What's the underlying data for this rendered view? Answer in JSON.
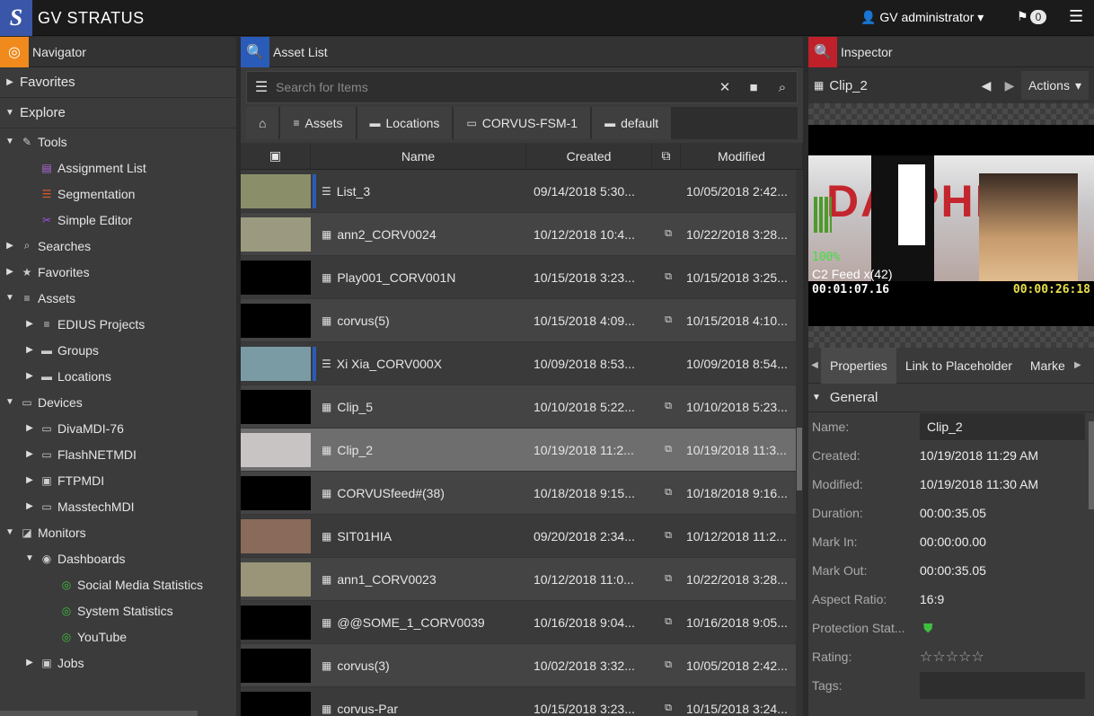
{
  "app": {
    "logo": "S",
    "title": "GV STRATUS",
    "user": "GV administrator",
    "notifications": "0"
  },
  "navigator": {
    "title": "Navigator",
    "favorites": "Favorites",
    "explore": "Explore",
    "tree": [
      {
        "label": "Tools",
        "icon": "wrench-icon"
      },
      {
        "label": "Assignment List",
        "icon": "assignment-icon"
      },
      {
        "label": "Segmentation",
        "icon": "segmentation-icon"
      },
      {
        "label": "Simple Editor",
        "icon": "scissors-icon"
      },
      {
        "label": "Searches",
        "icon": "searches-icon"
      },
      {
        "label": "Favorites",
        "icon": "favorites-folder-icon"
      },
      {
        "label": "Assets",
        "icon": "database-icon"
      },
      {
        "label": "EDIUS Projects",
        "icon": "database-icon"
      },
      {
        "label": "Groups",
        "icon": "folder-icon"
      },
      {
        "label": "Locations",
        "icon": "folder-icon"
      },
      {
        "label": "Devices",
        "icon": "device-icon"
      },
      {
        "label": "DivaMDI-76",
        "icon": "device-icon"
      },
      {
        "label": "FlashNETMDI",
        "icon": "device-icon"
      },
      {
        "label": "FTPMDI",
        "icon": "ftp-icon"
      },
      {
        "label": "MasstechMDI",
        "icon": "device-icon"
      },
      {
        "label": "Monitors",
        "icon": "monitor-icon"
      },
      {
        "label": "Dashboards",
        "icon": "dashboard-icon"
      },
      {
        "label": "Social Media Statistics",
        "icon": "stats-icon"
      },
      {
        "label": "System Statistics",
        "icon": "stats-icon"
      },
      {
        "label": "YouTube",
        "icon": "stats-icon"
      },
      {
        "label": "Jobs",
        "icon": "jobs-icon"
      }
    ]
  },
  "asset_list": {
    "title": "Asset List",
    "search_placeholder": "Search for Items",
    "breadcrumbs": [
      "Assets",
      "Locations",
      "CORVUS-FSM-1",
      "default"
    ],
    "columns": {
      "name": "Name",
      "created": "Created",
      "modified": "Modified"
    },
    "rows": [
      {
        "name": "List_3",
        "created": "09/14/2018 5:30...",
        "modified": "10/05/2018 2:42...",
        "type": "list",
        "thumb": "#8a8f6a"
      },
      {
        "name": "ann2_CORV0024",
        "created": "10/12/2018 10:4...",
        "modified": "10/22/2018 3:28...",
        "type": "clip",
        "thumb": "#9b9a80"
      },
      {
        "name": "Play001_CORV001N",
        "created": "10/15/2018 3:23...",
        "modified": "10/15/2018 3:25...",
        "type": "clip",
        "thumb": "#000000"
      },
      {
        "name": "corvus(5)",
        "created": "10/15/2018 4:09...",
        "modified": "10/15/2018 4:10...",
        "type": "clip",
        "thumb": "#000000"
      },
      {
        "name": "Xi Xia_CORV000X",
        "created": "10/09/2018 8:53...",
        "modified": "10/09/2018 8:54...",
        "type": "list",
        "thumb": "#7a9aa4"
      },
      {
        "name": "Clip_5",
        "created": "10/10/2018 5:22...",
        "modified": "10/10/2018 5:23...",
        "type": "clip",
        "thumb": "#000000"
      },
      {
        "name": "Clip_2",
        "created": "10/19/2018 11:2...",
        "modified": "10/19/2018 11:3...",
        "type": "clip",
        "thumb": "#c9c4c4",
        "selected": true
      },
      {
        "name": "CORVUSfeed#(38)",
        "created": "10/18/2018 9:15...",
        "modified": "10/18/2018 9:16...",
        "type": "clip",
        "thumb": "#000000"
      },
      {
        "name": "SIT01HIA",
        "created": "09/20/2018 2:34...",
        "modified": "10/12/2018 11:2...",
        "type": "clip",
        "thumb": "#8a6a5a"
      },
      {
        "name": "ann1_CORV0023",
        "created": "10/12/2018 11:0...",
        "modified": "10/22/2018 3:28...",
        "type": "clip",
        "thumb": "#9a9478"
      },
      {
        "name": "@@SOME_1_CORV0039",
        "created": "10/16/2018 9:04...",
        "modified": "10/16/2018 9:05...",
        "type": "clip",
        "thumb": "#000000"
      },
      {
        "name": "corvus(3)",
        "created": "10/02/2018 3:32...",
        "modified": "10/05/2018 2:42...",
        "type": "clip",
        "thumb": "#000000"
      },
      {
        "name": "corvus-Par",
        "created": "10/15/2018 3:23...",
        "modified": "10/15/2018 3:24...",
        "type": "clip",
        "thumb": "#000000"
      }
    ]
  },
  "inspector": {
    "title": "Inspector",
    "clip_name": "Clip_2",
    "actions_label": "Actions",
    "video": {
      "banner": "DAIPHIN",
      "percent": "100%",
      "feed": "C2 Feed x(42)",
      "timecode_left": "00:01:07.16",
      "timecode_right": "00:00:26:18"
    },
    "tabs": [
      "Properties",
      "Link to Placeholder",
      "Marke"
    ],
    "section": "General",
    "properties": [
      {
        "label": "Name:",
        "value": "Clip_2",
        "boxed": true
      },
      {
        "label": "Created:",
        "value": "10/19/2018 11:29 AM"
      },
      {
        "label": "Modified:",
        "value": "10/19/2018 11:30 AM"
      },
      {
        "label": "Duration:",
        "value": "00:00:35.05"
      },
      {
        "label": "Mark In:",
        "value": "00:00:00.00"
      },
      {
        "label": "Mark Out:",
        "value": "00:00:35.05"
      },
      {
        "label": "Aspect Ratio:",
        "value": "16:9"
      },
      {
        "label": "Protection Stat...",
        "value": "",
        "shield": true
      },
      {
        "label": "Rating:",
        "value": "☆☆☆☆☆"
      },
      {
        "label": "Tags:",
        "value": "",
        "boxed": true
      }
    ],
    "colors": {
      "accent_blue": "#2a5bb8",
      "accent_orange": "#f08a1c",
      "accent_red": "#c0202a",
      "green": "#3fbf3f"
    }
  }
}
